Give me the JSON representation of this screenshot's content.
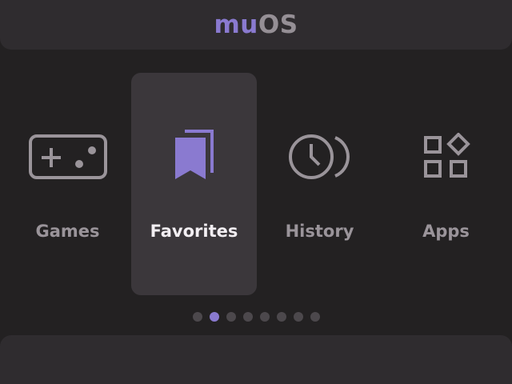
{
  "header": {
    "title_accent": "mu",
    "title_rest": "OS"
  },
  "menu": {
    "items": [
      {
        "label": "Games",
        "icon": "gamepad-icon",
        "selected": false
      },
      {
        "label": "Favorites",
        "icon": "bookmark-icon",
        "selected": true
      },
      {
        "label": "History",
        "icon": "history-clock-icon",
        "selected": false
      },
      {
        "label": "Apps",
        "icon": "apps-grid-icon",
        "selected": false
      }
    ]
  },
  "pagination": {
    "total": 8,
    "active_index": 1
  },
  "colors": {
    "accent": "#8a7ad0",
    "background": "#232122",
    "panel": "#2f2c2f",
    "selected_tile": "#3b373b",
    "icon": "#9a949a",
    "selected_label": "#f2eef2"
  }
}
